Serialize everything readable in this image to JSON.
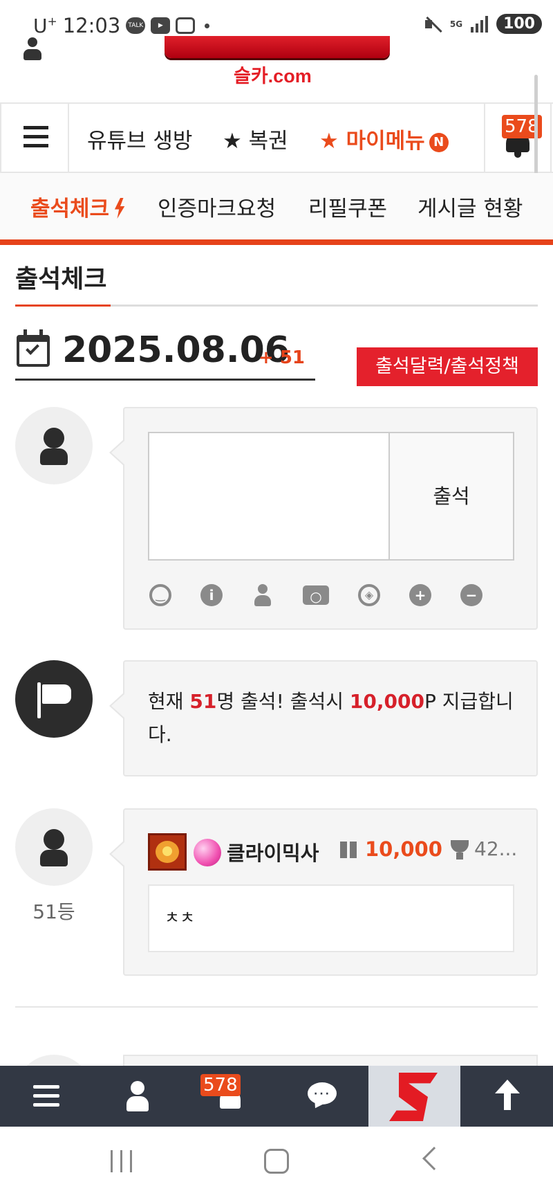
{
  "status_bar": {
    "carrier": "U",
    "carrier_sup": "+",
    "time": "12:03",
    "talk_icon": "TALK",
    "network": "5G",
    "battery": "100"
  },
  "site": {
    "logo_text": "슬카.com",
    "brand_color": "#e41e26",
    "accent_color": "#ea4b1c"
  },
  "nav": {
    "items": [
      {
        "label": "유튜브 생방"
      },
      {
        "label": "★ 복권"
      },
      {
        "label": "★ 마이메뉴"
      }
    ],
    "new_badge": "N",
    "notification_count": "578"
  },
  "subnav": {
    "items": [
      {
        "label": "출석체크"
      },
      {
        "label": "인증마크요청"
      },
      {
        "label": "리필쿠폰"
      },
      {
        "label": "게시글 현황"
      }
    ]
  },
  "page": {
    "title": "출석체크",
    "date": "2025.08.06",
    "count": "+ 51",
    "policy_button": "출석달력/출석정책"
  },
  "attendance_form": {
    "textarea_value": "",
    "submit_label": "출석",
    "tool_icons": [
      "smile-icon",
      "info-icon",
      "user-icon",
      "camera-icon",
      "compass-icon",
      "plus-circle-icon",
      "minus-circle-icon"
    ]
  },
  "notice": {
    "prefix": "현재 ",
    "count": "51",
    "mid": "명 출석! 출석시 ",
    "points": "10,000",
    "suffix": "P 지급합니다."
  },
  "entry": {
    "rank": "51등",
    "username": "클라이믹사",
    "points": "10,000",
    "rank_value": "42...",
    "comment": "ㅊㅊ"
  },
  "bottom_bar": {
    "notification_count": "578"
  }
}
